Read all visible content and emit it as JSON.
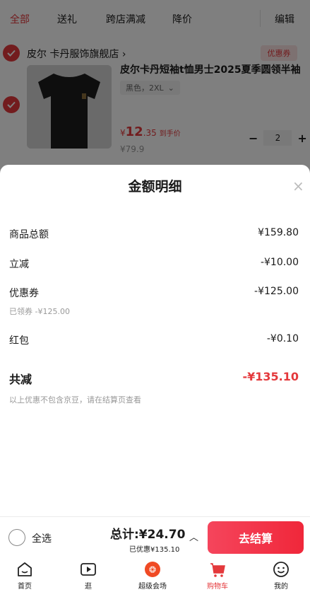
{
  "top_tabs": {
    "all": "全部",
    "gift": "送礼",
    "cross_store": "跨店满减",
    "price_drop": "降价",
    "edit": "编辑"
  },
  "shop": {
    "name": "皮尔 卡丹服饰旗舰店",
    "chevron": "›",
    "coupon_tag": "优惠券"
  },
  "product": {
    "title": "皮尔卡丹短袖t恤男士2025夏季圆领半袖",
    "sku": "黑色，2XL",
    "price_symbol": "¥",
    "price_int": "12",
    "price_dec": ".35",
    "price_tag": "到手价",
    "original_price": "¥79.9",
    "quantity": "2",
    "minus": "−",
    "plus": "+"
  },
  "sheet": {
    "title": "金额明细",
    "close": "×",
    "rows": [
      {
        "label": "商品总额",
        "value": "¥159.80"
      },
      {
        "label": "立减",
        "value": "-¥10.00"
      },
      {
        "label": "优惠券",
        "value": "-¥125.00"
      },
      {
        "label": "红包",
        "value": "-¥0.10"
      }
    ],
    "coupon_sub": "已领券 -¥125.00",
    "total_label": "共减",
    "total_value": "-¥135.10",
    "note": "以上优惠不包含京豆，请在结算页查看"
  },
  "checkout": {
    "select_all": "全选",
    "total": "总计:¥24.70",
    "saved": "已优惠¥135.10",
    "caret": "︿",
    "pay_button": "去结算"
  },
  "tabbar": [
    {
      "label": "首页",
      "icon": "home-icon"
    },
    {
      "label": "逛",
      "icon": "play-icon"
    },
    {
      "label": "超级会场",
      "icon": "venue-icon"
    },
    {
      "label": "购物车",
      "icon": "cart-icon"
    },
    {
      "label": "我的",
      "icon": "profile-icon"
    }
  ],
  "colors": {
    "accent": "#e4393c"
  }
}
